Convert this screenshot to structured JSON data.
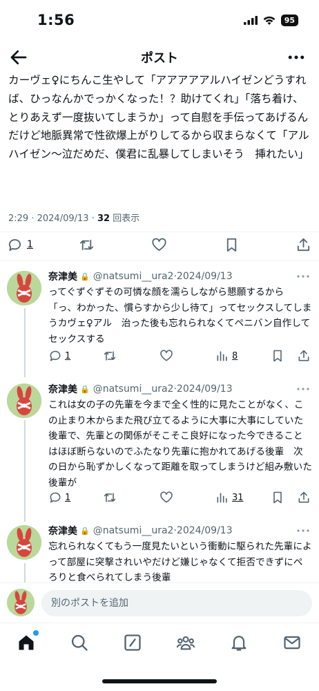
{
  "status_bar": {
    "time": "1:56",
    "battery": "95"
  },
  "nav": {
    "title": "ポスト"
  },
  "post": {
    "text": "カーヴェ♀にちんこ生やして「アアアアアルハイゼンどうすれば、ひっなんかでっかくなった！？助けてくれ」「落ち着け、とりあえず一度抜いてしまうか」って自慰を手伝ってあげるんだけど地脈異常で性欲爆上がりしてるから収まらなくて「アルハイゼン〜泣だめだ、僕君に乱暴してしまいそう　挿れたい」",
    "time": "2:29",
    "date": "2024/09/13",
    "views_count": "32",
    "views_label": "回表示",
    "actions": {
      "reply_count": "1"
    }
  },
  "replies": [
    {
      "name": "奈津美",
      "handle": "@natsumi__ura2",
      "date": "2024/09/13",
      "text": "ってぐずぐずその可憐な顔を濡らしながら懇願するから「っ、わかった、慣らすから少し待て」ってセックスしてしまうカヴェ♀アル　治った後も忘れられなくてペニバン自作してセックスする",
      "reply_count": "1",
      "views_count": "8"
    },
    {
      "name": "奈津美",
      "handle": "@natsumi__ura2",
      "date": "2024/09/13",
      "text": "これは女の子の先輩を今まで全く性的に見たことがなく、この止まり木からまた飛び立てるように大事に大事にしていた後輩で、先輩との関係がそこそこ良好になった今できることはほぼ断らないのでふたなり先輩に抱かれてあげる後輩　次の日から恥ずかしくなって距離を取ってしまうけど組み敷いた後輩が",
      "reply_count": "1",
      "views_count": "31"
    },
    {
      "name": "奈津美",
      "handle": "@natsumi__ura2",
      "date": "2024/09/13",
      "text": "忘れられなくてもう一度見たいという衝動に駆られた先輩によって部屋に突撃されいやだけど嫌じゃなくて拒否できずにぺろりと食べられてしまう後輩"
    }
  ],
  "compose": {
    "placeholder": "別のポストを追加"
  },
  "tabs": [
    "home-icon",
    "search-icon",
    "grok-icon",
    "communities-icon",
    "notifications-icon",
    "messages-icon"
  ],
  "colors": {
    "accent": "#1d9bf0",
    "text": "#0f1419",
    "muted": "#536471",
    "avatar_bg": "#b9d89a",
    "avatar_figure": "#d8453f"
  }
}
